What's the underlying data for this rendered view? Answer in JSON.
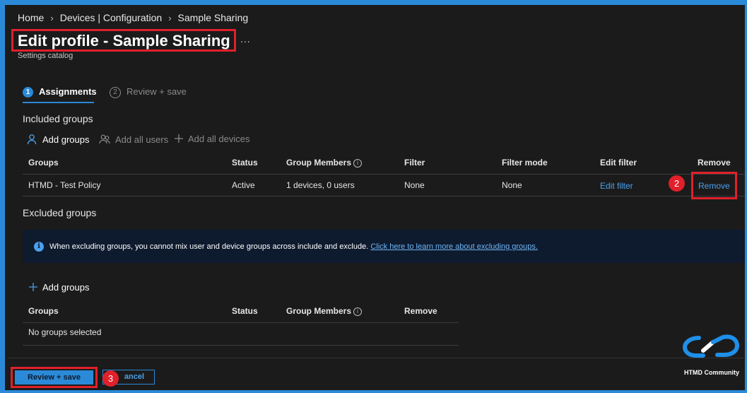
{
  "breadcrumb": [
    "Home",
    "Devices | Configuration",
    "Sample Sharing"
  ],
  "page": {
    "title": "Edit profile - Sample Sharing",
    "more": "...",
    "subtitle": "Settings catalog"
  },
  "steps": [
    {
      "number": "1",
      "label": "Assignments"
    },
    {
      "number": "2",
      "label": "Review + save"
    }
  ],
  "included": {
    "heading": "Included groups",
    "commands": {
      "add_groups": "Add groups",
      "add_all_users": "Add all users",
      "add_all_devices": "Add all devices"
    },
    "columns": [
      "Groups",
      "Status",
      "Group Members",
      "Filter",
      "Filter mode",
      "Edit filter",
      "Remove"
    ],
    "rows": [
      {
        "group": "HTMD - Test Policy",
        "status": "Active",
        "members": "1 devices, 0 users",
        "filter": "None",
        "filter_mode": "None",
        "edit_filter": "Edit filter",
        "remove": "Remove"
      }
    ]
  },
  "excluded": {
    "heading": "Excluded groups",
    "info_text": "When excluding groups, you cannot mix user and device groups across include and exclude.",
    "info_link": "Click here to learn more about excluding groups.",
    "add_groups": "Add groups",
    "columns": [
      "Groups",
      "Status",
      "Group Members",
      "Remove"
    ],
    "empty": "No groups selected"
  },
  "footer": {
    "review_save": "Review + save",
    "cancel": "ancel"
  },
  "annotations": [
    "2",
    "3"
  ],
  "logo": {
    "caption": "HTMD Community"
  },
  "colors": {
    "accent": "#2b8ad8",
    "highlight": "#e0202b",
    "background": "#1b1b1b",
    "banner": "#0e1a2e"
  }
}
